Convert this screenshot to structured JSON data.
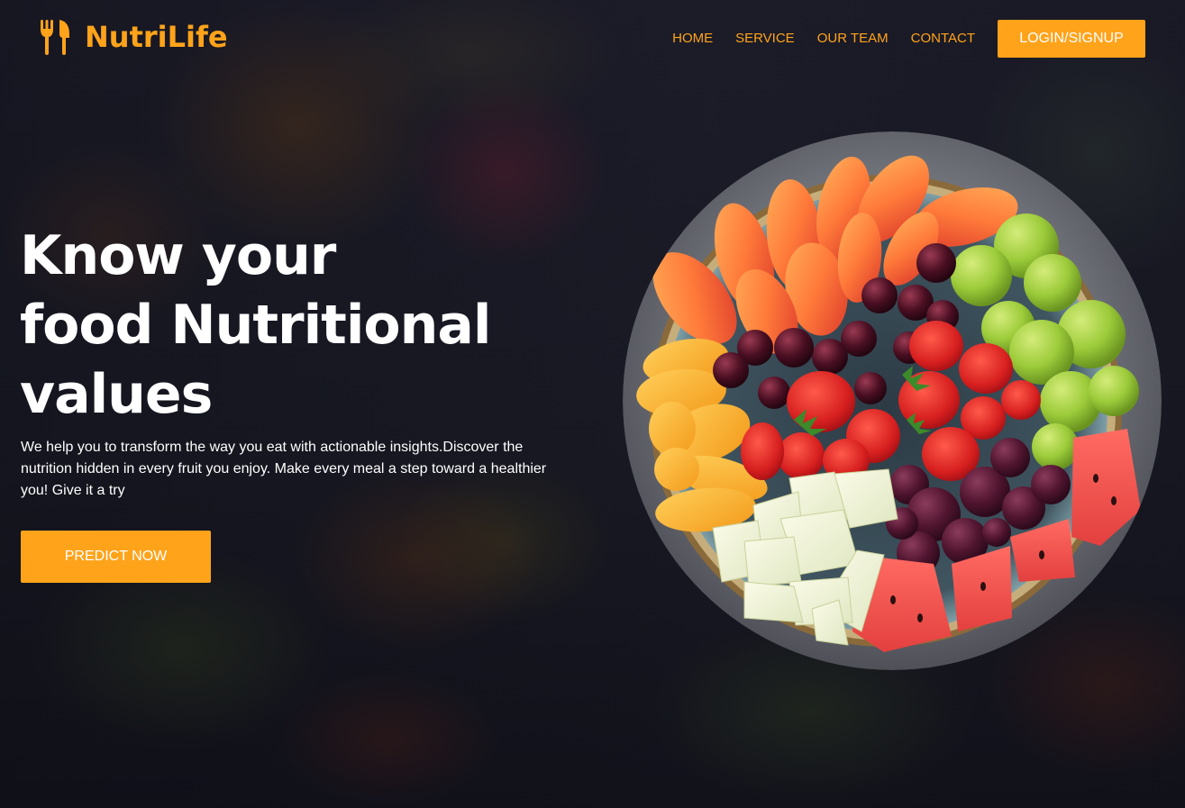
{
  "brand": {
    "name": "NutriLife",
    "icon": "fork-knife-icon",
    "color": "#ffa31a"
  },
  "nav": {
    "items": [
      {
        "label": "HOME"
      },
      {
        "label": "SERVICE"
      },
      {
        "label": "OUR TEAM"
      },
      {
        "label": "CONTACT"
      }
    ],
    "login_label": "LOGIN/SIGNUP"
  },
  "hero": {
    "title_lines": [
      "Know your",
      "food Nutritional",
      "values"
    ],
    "description": "We help you to transform the way you eat with actionable insights.Discover the nutrition hidden in every fruit you enjoy. Make every meal a step toward a healthier you! Give it a try",
    "cta_label": "PREDICT NOW"
  },
  "images": {
    "hero_image": "fruit-bowl",
    "background": "dark-fruit-market"
  },
  "colors": {
    "accent": "#ffa31a",
    "background": "#191a24",
    "text": "#ffffff"
  }
}
